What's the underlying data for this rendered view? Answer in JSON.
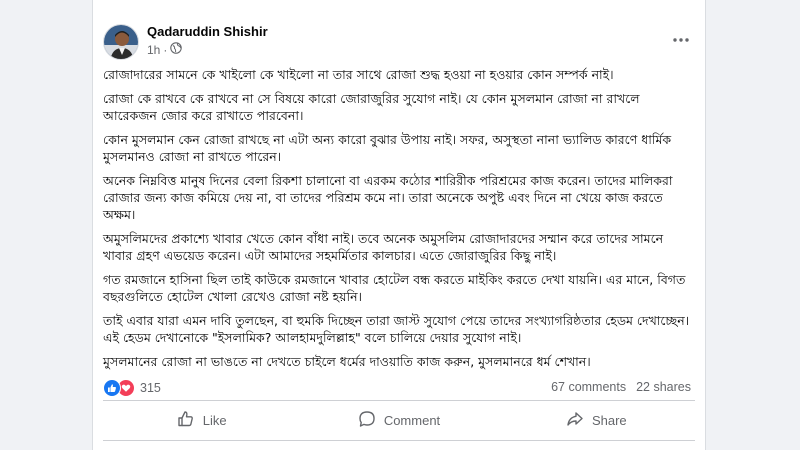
{
  "post": {
    "author": "Qadaruddin Shishir",
    "time": "1h",
    "time_separator": "·",
    "paragraphs": [
      "রোজাদারের সামনে কে খাইলো কে খাইলো না তার সাথে রোজা শুদ্ধ হওয়া না হওয়ার কোন সম্পর্ক নাই।",
      "রোজা কে রাখবে কে রাখবে না সে বিষয়ে কারো জোরাজুরির সুযোগ নাই। যে কোন মুসলমান রোজা না রাখলে আরেকজন জোর করে রাখাতে পারবেনা।",
      "কোন মুসলমান কেন রোজা রাখছে না এটা অন্য কারো বুঝার উপায় নাই। সফর, অসুস্থতা নানা ভ্যালিড কারণে ধার্মিক মুসলমানও রোজা না রাখতে পারেন।",
      "অনেক নিম্নবিত্ত মানুষ দিনের বেলা রিকশা চালানো বা এরকম কঠোর শারিরীক পরিশ্রমের কাজ করেন। তাদের মালিকরা রোজার জন্য কাজ কমিয়ে দেয় না, বা তাদের পরিশ্রম কমে না। তারা অনেকে অপুষ্ট এবং দিনে না খেয়ে কাজ করতে অক্ষম।",
      "অমুসলিমদের প্রকাশ্যে খাবার খেতে কোন বাঁধা নাই। তবে অনেক অমুসলিম রোজাদারদের সম্মান করে তাদের সামনে খাবার গ্রহণ এভয়েড করেন। এটা আমাদের সহমর্মিতার কালচার। এতে জোরাজুরির কিছু নাই।",
      "গত রমজানে হাসিনা ছিল তাই কাউকে রমজানে খাবার হোটেল বন্ধ করতে মাইকিং করতে দেখা যায়নি। এর মানে, বিগত বছরগুলিতে হোটেল খোলা রেখেও রোজা নষ্ট হয়নি।",
      "তাই এবার যারা এমন দাবি তুলছেন, বা হুমকি দিচ্ছেন তারা জাস্ট সুযোগ পেয়ে তাদের সংখ্যাগরিষ্ঠতার হেডম দেখাচ্ছেন। এই হেডম দেখানোকে \"ইসলামিক? আলহামদুলিল্লাহ\" বলে চালিয়ে দেয়ার সুযোগ নাই।",
      "মুসলমানের রোজা না ভাঙতে না দেখতে চাইলে ধর্মের দাওয়াতি কাজ করুন, মুসলমানরে ধর্ম শেখান।"
    ]
  },
  "stats": {
    "reactions_count": "315",
    "comments": "67 comments",
    "shares": "22 shares"
  },
  "actions": {
    "like": "Like",
    "comment": "Comment",
    "share": "Share"
  },
  "icons": {
    "globe": "globe-icon",
    "more": "more-options-icon",
    "like_reaction": "like-reaction-icon",
    "love_reaction": "love-reaction-icon",
    "like_action": "thumbs-up-icon",
    "comment_action": "comment-bubble-icon",
    "share_action": "share-arrow-icon"
  },
  "colors": {
    "brand_blue": "#1877f2",
    "love_red": "#f33e58",
    "secondary_text": "#65676b",
    "primary_text": "#050505"
  }
}
